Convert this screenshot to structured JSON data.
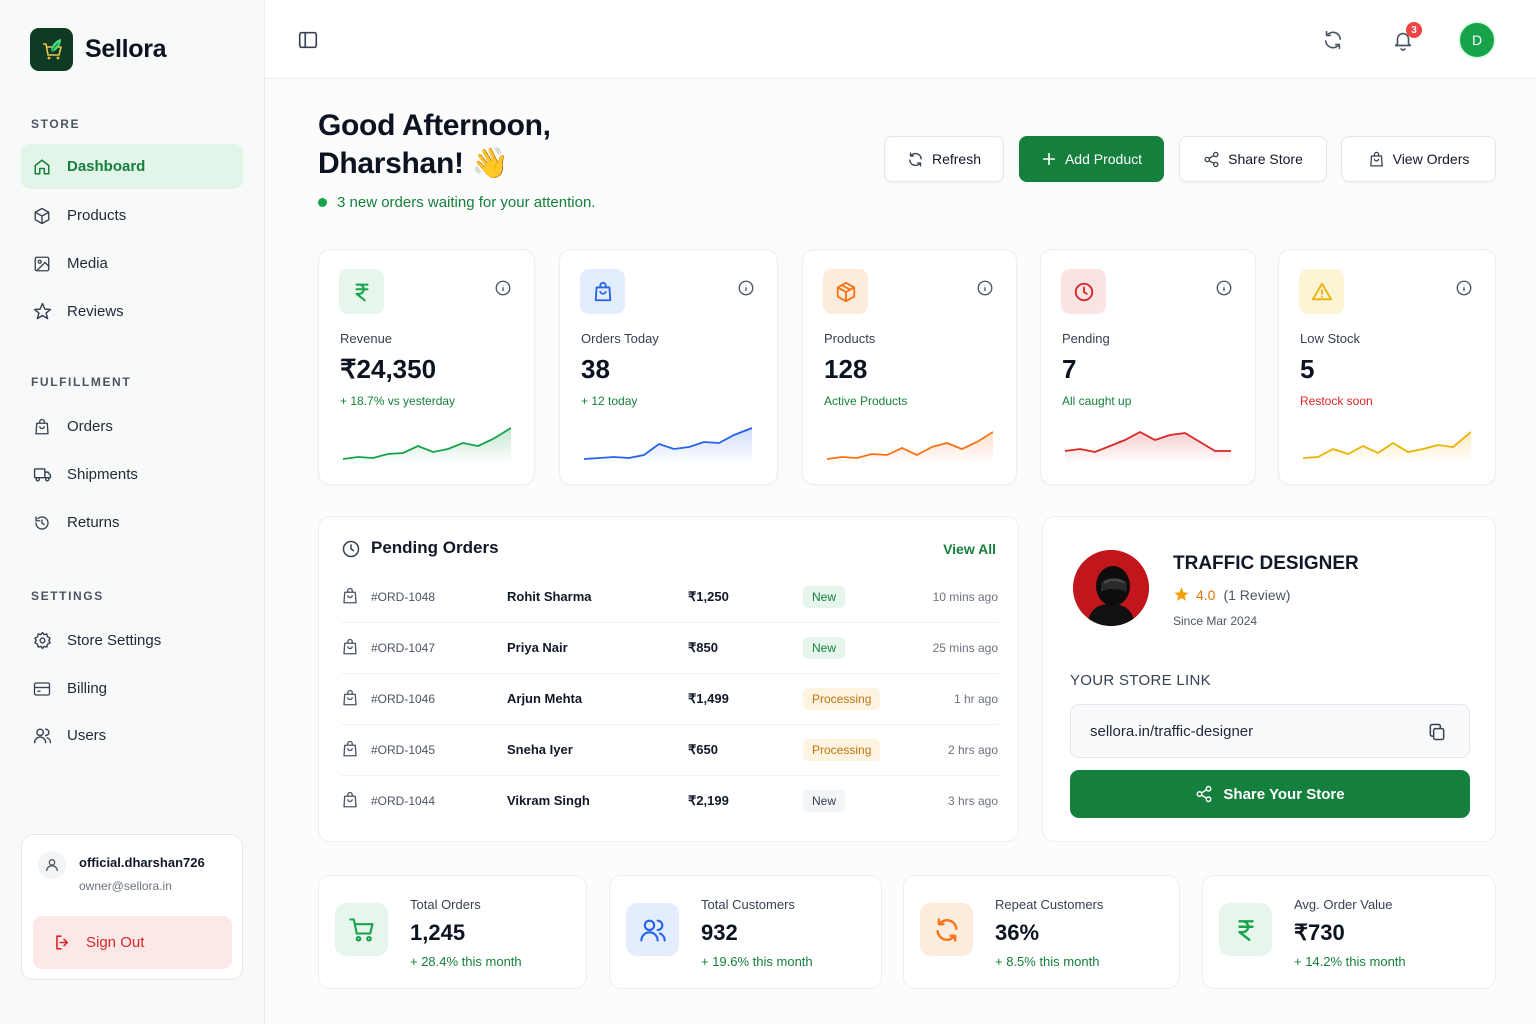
{
  "brand": {
    "name": "Sellora"
  },
  "sidebar": {
    "sections": [
      {
        "label": "STORE",
        "items": [
          {
            "label": "Dashboard",
            "icon": "home-icon",
            "active": true
          },
          {
            "label": "Products",
            "icon": "box-icon"
          },
          {
            "label": "Media",
            "icon": "image-icon"
          },
          {
            "label": "Reviews",
            "icon": "star-icon"
          }
        ]
      },
      {
        "label": "FULFILLMENT",
        "items": [
          {
            "label": "Orders",
            "icon": "shopping-bag-icon"
          },
          {
            "label": "Shipments",
            "icon": "truck-icon"
          },
          {
            "label": "Returns",
            "icon": "history-icon"
          }
        ]
      },
      {
        "label": "SETTINGS",
        "items": [
          {
            "label": "Store Settings",
            "icon": "gear-icon"
          },
          {
            "label": "Billing",
            "icon": "credit-card-icon"
          },
          {
            "label": "Users",
            "icon": "users-icon"
          }
        ]
      }
    ],
    "user": {
      "name": "official.dharshan726",
      "email": "owner@sellora.in",
      "signout_label": "Sign Out"
    }
  },
  "topbar": {
    "notification_count": "3",
    "avatar_initial": "D"
  },
  "greeting": {
    "line1": "Good Afternoon,",
    "line2": "Dharshan! 👋",
    "notice": "3 new orders waiting for your attention."
  },
  "actions": {
    "refresh": "Refresh",
    "add_product": "Add Product",
    "share_store": "Share Store",
    "view_orders": "View Orders"
  },
  "stats": [
    {
      "label": "Revenue",
      "value": "₹24,350",
      "sub": "+ 18.7% vs yesterday",
      "color": "#16a34a",
      "bg": "#e7f6ec",
      "icon": "rupee-icon"
    },
    {
      "label": "Orders Today",
      "value": "38",
      "sub": "+ 12 today",
      "color": "#2563eb",
      "bg": "#e3edfd",
      "icon": "shopping-bag-icon"
    },
    {
      "label": "Products",
      "value": "128",
      "sub": "Active Products",
      "color": "#f97316",
      "bg": "#fdecdc",
      "icon": "box-icon"
    },
    {
      "label": "Pending",
      "value": "7",
      "sub": "All caught up",
      "color": "#dc2626",
      "bg": "#fde4e4",
      "icon": "clock-icon"
    },
    {
      "label": "Low Stock",
      "value": "5",
      "sub": "Restock soon",
      "color": "#eab308",
      "bg": "#fdf4d6",
      "icon": "warning-icon"
    }
  ],
  "pending_orders": {
    "title": "Pending Orders",
    "view_all": "View All",
    "rows": [
      {
        "id": "#ORD-1048",
        "customer": "Rohit Sharma",
        "amount": "₹1,250",
        "status": "New",
        "status_type": "new",
        "time": "10 mins ago"
      },
      {
        "id": "#ORD-1047",
        "customer": "Priya Nair",
        "amount": "₹850",
        "status": "New",
        "status_type": "new",
        "time": "25 mins ago"
      },
      {
        "id": "#ORD-1046",
        "customer": "Arjun Mehta",
        "amount": "₹1,499",
        "status": "Processing",
        "status_type": "proc",
        "time": "1 hr ago"
      },
      {
        "id": "#ORD-1045",
        "customer": "Sneha Iyer",
        "amount": "₹650",
        "status": "Processing",
        "status_type": "proc",
        "time": "2 hrs ago"
      },
      {
        "id": "#ORD-1044",
        "customer": "Vikram Singh",
        "amount": "₹2,199",
        "status": "New",
        "status_type": "gray",
        "time": "3 hrs ago"
      }
    ]
  },
  "store": {
    "name": "TRAFFIC DESIGNER",
    "rating": "4.0",
    "reviews": "(1 Review)",
    "since": "Since Mar 2024",
    "link_label": "YOUR STORE LINK",
    "link": "sellora.in/traffic-designer",
    "share_label": "Share Your Store"
  },
  "summary": [
    {
      "label": "Total Orders",
      "value": "1,245",
      "change": "+ 28.4% this month",
      "color": "#16a34a",
      "bg": "#e7f6ec",
      "icon": "cart-icon"
    },
    {
      "label": "Total Customers",
      "value": "932",
      "change": "+ 19.6% this month",
      "color": "#2563eb",
      "bg": "#e3edfd",
      "icon": "users-icon"
    },
    {
      "label": "Repeat Customers",
      "value": "36%",
      "change": "+ 8.5% this month",
      "color": "#f97316",
      "bg": "#fdecdc",
      "icon": "repeat-icon"
    },
    {
      "label": "Avg. Order Value",
      "value": "₹730",
      "change": "+ 14.2% this month",
      "color": "#16a34a",
      "bg": "#e7f6ec",
      "icon": "rupee-icon"
    }
  ]
}
